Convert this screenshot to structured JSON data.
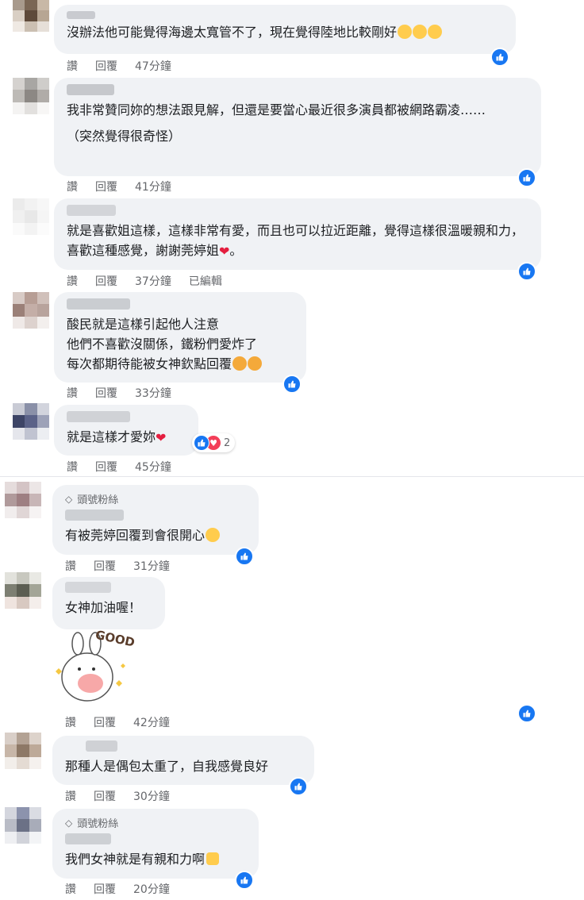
{
  "colors": {
    "like_blue": "#1877f2",
    "bubble_bg": "#f0f2f5",
    "meta_text": "#65676b",
    "heart_red": "#e41e3f"
  },
  "action_labels": {
    "like": "讚",
    "reply": "回覆",
    "edited": "已編輯"
  },
  "fan_badge": "頭號粉絲",
  "comments": [
    {
      "text": "沒辦法他可能覺得海邊太寬管不了，現在覺得陸地比較剛好",
      "time": "47分鐘"
    },
    {
      "text": "我非常贊同妳的想法跟見解，但還是要當心最近很多演員都被網路霸凌……",
      "text2": "（突然覺得很奇怪）",
      "time": "41分鐘"
    },
    {
      "text": "就是喜歡姐這樣，這樣非常有愛，而且也可以拉近距離，覺得這樣很溫暖親和力，喜歡這種感覺，謝謝莞婷姐",
      "tail": "。",
      "time": "37分鐘"
    },
    {
      "line1": "酸民就是這樣引起他人注意",
      "line2": "他們不喜歡沒關係，鐵粉們愛炸了",
      "line3": "每次都期待能被女神欽點回覆",
      "time": "33分鐘"
    },
    {
      "text": "就是這樣才愛妳",
      "reaction_count": "2",
      "time": "45分鐘"
    },
    {
      "text": "有被莞婷回覆到會很開心",
      "time": "31分鐘"
    },
    {
      "text": "女神加油喔！",
      "sticker_text": "GOOD",
      "time": "42分鐘"
    },
    {
      "text": "那種人是偶包太重了，自我感覺良好",
      "time": "30分鐘"
    },
    {
      "text": "我們女神就是有親和力啊",
      "time": "20分鐘"
    }
  ]
}
